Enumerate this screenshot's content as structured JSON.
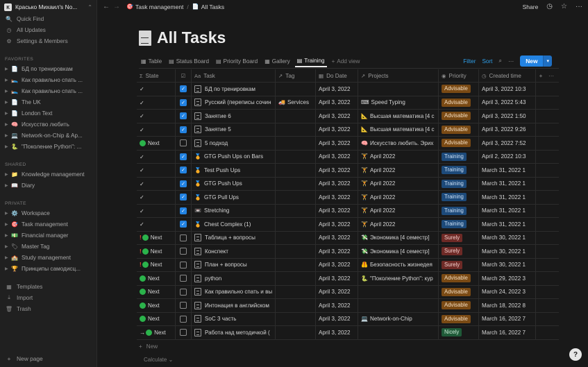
{
  "workspace": {
    "logo": "К",
    "name": "Красько Михаил's No..."
  },
  "sidebar": {
    "top": [
      {
        "label": "Quick Find",
        "icon": "🔍"
      },
      {
        "label": "All Updates",
        "icon": "◷"
      },
      {
        "label": "Settings & Members",
        "icon": "⚙"
      }
    ],
    "favorites_title": "FAVORITES",
    "favorites": [
      {
        "icon": "📄",
        "label": "БД по тренировкам"
      },
      {
        "icon": "🛌",
        "label": "Как правильно спать ..."
      },
      {
        "icon": "🛌",
        "label": "Как правильно спать ..."
      },
      {
        "icon": "📄",
        "label": "The UK"
      },
      {
        "icon": "📄",
        "label": "London Text"
      },
      {
        "icon": "🧠",
        "label": "Искусство любить"
      },
      {
        "icon": "💻",
        "label": "Network-on-Chip & Ap..."
      },
      {
        "icon": "🐍",
        "label": "\"Поколение Python\": ..."
      }
    ],
    "shared_title": "SHARED",
    "shared": [
      {
        "icon": "📁",
        "label": "Knowledge management"
      },
      {
        "icon": "📖",
        "label": "Diary"
      }
    ],
    "private_title": "PRIVATE",
    "private": [
      {
        "icon": "⚙️",
        "label": "Workspace"
      },
      {
        "icon": "🎯",
        "label": "Task management"
      },
      {
        "icon": "💵",
        "label": "Financial manager"
      },
      {
        "icon": "🏷",
        "label": "Master Tag"
      },
      {
        "icon": "🏫",
        "label": "Study management"
      },
      {
        "icon": "🏆",
        "label": "Принципы самодисц..."
      }
    ],
    "bottom": [
      {
        "label": "Templates",
        "icon": "▦"
      },
      {
        "label": "Import",
        "icon": "⤓"
      },
      {
        "label": "Trash",
        "icon": "🗑"
      }
    ],
    "new_page": "New page"
  },
  "topbar": {
    "crumb1_icon": "🎯",
    "crumb1": "Task management",
    "crumb2_icon": "📄",
    "crumb2": "All Tasks",
    "share": "Share"
  },
  "page": {
    "title": "All Tasks"
  },
  "views": {
    "tabs": [
      {
        "icon": "▦",
        "label": "Table",
        "active": false
      },
      {
        "icon": "▤",
        "label": "Status Board",
        "active": false
      },
      {
        "icon": "▤",
        "label": "Priority Board",
        "active": false
      },
      {
        "icon": "▦",
        "label": "Gallery",
        "active": false
      },
      {
        "icon": "▤",
        "label": "Training",
        "active": true
      }
    ],
    "add_view": "Add view",
    "filter": "Filter",
    "sort": "Sort",
    "new": "New"
  },
  "columns": {
    "state": "State",
    "task": "Task",
    "tag": "Tag",
    "do_date": "Do Date",
    "projects": "Projects",
    "priority": "Priority",
    "created": "Created time"
  },
  "priority_colors": {
    "Advisable": {
      "bg": "#7a4a14",
      "fg": "#f2dcc0"
    },
    "Training": {
      "bg": "#1d4a7a",
      "fg": "#cfe2f7"
    },
    "Surely": {
      "bg": "#6e2a26",
      "fg": "#f5d2cf"
    },
    "Nicely": {
      "bg": "#1f5a38",
      "fg": "#cdebd8"
    }
  },
  "rows": [
    {
      "excl": "",
      "arrow": "",
      "dot": false,
      "state": "✓",
      "checked": true,
      "task_icon": "",
      "task": "БД по тренировкам",
      "tag_icon": "",
      "tag": "",
      "date": "April 3, 2022",
      "proj_icon": "",
      "project": "",
      "priority": "Advisable",
      "created": "April 3, 2022 10:3"
    },
    {
      "excl": "",
      "arrow": "",
      "dot": false,
      "state": "✓",
      "checked": true,
      "task_icon": "",
      "task": "Русский (переписы сочин",
      "tag_icon": "🚚",
      "tag": "Services",
      "date": "April 3, 2022",
      "proj_icon": "⌨",
      "project": "Speed Typing",
      "priority": "Advisable",
      "created": "April 3, 2022 5:43"
    },
    {
      "excl": "",
      "arrow": "",
      "dot": false,
      "state": "✓",
      "checked": true,
      "task_icon": "",
      "task": "Занятие 6",
      "tag_icon": "",
      "tag": "",
      "date": "April 3, 2022",
      "proj_icon": "📐",
      "project": "Высшая математика [4 с",
      "priority": "Advisable",
      "created": "April 3, 2022 1:50"
    },
    {
      "excl": "",
      "arrow": "",
      "dot": false,
      "state": "✓",
      "checked": true,
      "task_icon": "",
      "task": "Занятие 5",
      "tag_icon": "",
      "tag": "",
      "date": "April 3, 2022",
      "proj_icon": "📐",
      "project": "Высшая математика [4 с",
      "priority": "Advisable",
      "created": "April 3, 2022 9:26"
    },
    {
      "excl": "",
      "arrow": "",
      "dot": true,
      "state": "Next",
      "checked": false,
      "task_icon": "",
      "task": "5 подход",
      "tag_icon": "",
      "tag": "",
      "date": "April 3, 2022",
      "proj_icon": "🧠",
      "project": "Искусство любить. Эрих",
      "priority": "Advisable",
      "created": "April 3, 2022 7:52"
    },
    {
      "excl": "",
      "arrow": "",
      "dot": false,
      "state": "✓",
      "checked": true,
      "task_icon": "🏅",
      "task": "GTG Push Ups on Bars",
      "tag_icon": "",
      "tag": "",
      "date": "April 3, 2022",
      "proj_icon": "🏋",
      "project": "April 2022",
      "priority": "Training",
      "created": "April 2, 2022 10:3"
    },
    {
      "excl": "",
      "arrow": "",
      "dot": false,
      "state": "✓",
      "checked": true,
      "task_icon": "🏅",
      "task": "Test Push Ups",
      "tag_icon": "",
      "tag": "",
      "date": "April 3, 2022",
      "proj_icon": "🏋",
      "project": "April 2022",
      "priority": "Training",
      "created": "March 31, 2022 1"
    },
    {
      "excl": "",
      "arrow": "",
      "dot": false,
      "state": "✓",
      "checked": true,
      "task_icon": "🏅",
      "task": "GTG Push Ups",
      "tag_icon": "",
      "tag": "",
      "date": "April 3, 2022",
      "proj_icon": "🏋",
      "project": "April 2022",
      "priority": "Training",
      "created": "March 31, 2022 1"
    },
    {
      "excl": "",
      "arrow": "",
      "dot": false,
      "state": "✓",
      "checked": true,
      "task_icon": "🏅",
      "task": "GTG Pull Ups",
      "tag_icon": "",
      "tag": "",
      "date": "April 3, 2022",
      "proj_icon": "🏋",
      "project": "April 2022",
      "priority": "Training",
      "created": "March 31, 2022 1"
    },
    {
      "excl": "",
      "arrow": "",
      "dot": false,
      "state": "✓",
      "checked": true,
      "task_icon": "📼",
      "task": "Stretching",
      "tag_icon": "",
      "tag": "",
      "date": "April 3, 2022",
      "proj_icon": "🏋",
      "project": "April 2022",
      "priority": "Training",
      "created": "March 31, 2022 1"
    },
    {
      "excl": "",
      "arrow": "",
      "dot": false,
      "state": "✓",
      "checked": true,
      "task_icon": "🏅",
      "task": "Chest Complex (1)",
      "tag_icon": "",
      "tag": "",
      "date": "April 3, 2022",
      "proj_icon": "🏋",
      "project": "April 2022",
      "priority": "Training",
      "created": "March 31, 2022 1"
    },
    {
      "excl": "!",
      "arrow": "",
      "dot": true,
      "state": "Next",
      "checked": false,
      "task_icon": "",
      "task": "Таблица + вопросы",
      "tag_icon": "",
      "tag": "",
      "date": "April 3, 2022",
      "proj_icon": "💸",
      "project": "Экономика [4 семестр]",
      "priority": "Surely",
      "created": "March 30, 2022 1"
    },
    {
      "excl": "!",
      "arrow": "",
      "dot": true,
      "state": "Next",
      "checked": false,
      "task_icon": "",
      "task": "Конспект",
      "tag_icon": "",
      "tag": "",
      "date": "April 3, 2022",
      "proj_icon": "💸",
      "project": "Экономика [4 семестр]",
      "priority": "Surely",
      "created": "March 30, 2022 1"
    },
    {
      "excl": "!",
      "arrow": "",
      "dot": true,
      "state": "Next",
      "checked": false,
      "task_icon": "",
      "task": "План + вопросы",
      "tag_icon": "",
      "tag": "",
      "date": "April 3, 2022",
      "proj_icon": "🦺",
      "project": "Безопасность жизнедея",
      "priority": "Surely",
      "created": "March 30, 2022 1"
    },
    {
      "excl": "",
      "arrow": "",
      "dot": true,
      "state": "Next",
      "checked": false,
      "task_icon": "",
      "task": "python",
      "tag_icon": "",
      "tag": "",
      "date": "April 3, 2022",
      "proj_icon": "🐍",
      "project": "\"Поколение Python\": кур",
      "priority": "Advisable",
      "created": "March 29, 2022 3"
    },
    {
      "excl": "",
      "arrow": "",
      "dot": true,
      "state": "Next",
      "checked": false,
      "task_icon": "",
      "task": "Как правильно спать и вы",
      "tag_icon": "",
      "tag": "",
      "date": "April 3, 2022",
      "proj_icon": "",
      "project": "",
      "priority": "Advisable",
      "created": "March 24, 2022 3"
    },
    {
      "excl": "",
      "arrow": "",
      "dot": true,
      "state": "Next",
      "checked": false,
      "task_icon": "",
      "task": "Интонация в английском",
      "tag_icon": "",
      "tag": "",
      "date": "April 3, 2022",
      "proj_icon": "",
      "project": "",
      "priority": "Advisable",
      "created": "March 18, 2022 8"
    },
    {
      "excl": "",
      "arrow": "",
      "dot": true,
      "state": "Next",
      "checked": false,
      "task_icon": "",
      "task": "SoC 3 часть",
      "tag_icon": "",
      "tag": "",
      "date": "April 3, 2022",
      "proj_icon": "💻",
      "project": "Network-on-Chip",
      "priority": "Advisable",
      "created": "March 16, 2022 7"
    },
    {
      "excl": "",
      "arrow": "→",
      "dot": true,
      "state": "Next",
      "checked": false,
      "task_icon": "",
      "task": "Работа над методичкой (",
      "tag_icon": "",
      "tag": "",
      "date": "April 3, 2022",
      "proj_icon": "",
      "project": "",
      "priority": "Nicely",
      "created": "March 16, 2022 7"
    }
  ],
  "footer": {
    "new": "New",
    "calculate": "Calculate"
  },
  "help": "?"
}
